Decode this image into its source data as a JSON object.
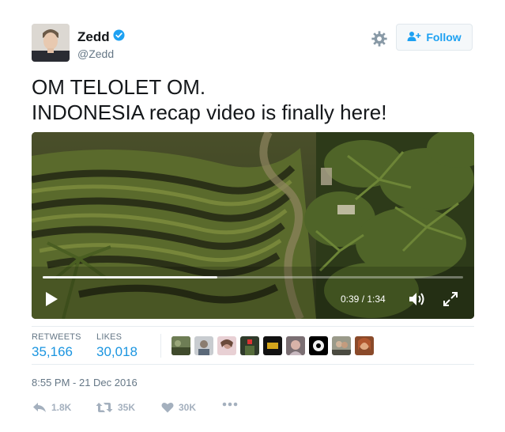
{
  "author": {
    "name": "Zedd",
    "handle": "@Zedd",
    "verified": true
  },
  "header": {
    "follow_label": "Follow",
    "settings_icon": "gear-icon",
    "accent_color": "#1da1f2"
  },
  "tweet": {
    "lines": [
      "OM TELOLET OM.",
      "INDONESIA recap video is finally here!"
    ]
  },
  "video": {
    "current_time": "0:39",
    "duration": "1:34",
    "time_display": "0:39 / 1:34",
    "progress_fraction": 0.415
  },
  "stats": {
    "retweets_label": "RETWEETS",
    "retweets_value": "35,166",
    "likes_label": "LIKES",
    "likes_value": "30,018",
    "liker_avatar_count": 9
  },
  "timestamp": "8:55 PM - 21 Dec 2016",
  "actions": {
    "reply_count": "1.8K",
    "retweet_count": "35K",
    "like_count": "30K"
  }
}
